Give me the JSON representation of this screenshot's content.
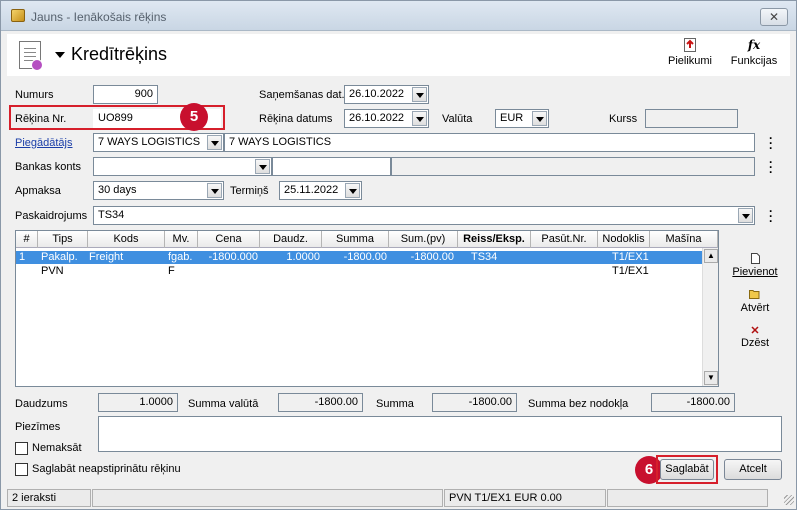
{
  "window": {
    "title": "Jauns - Ienākošais rēķins",
    "close": "✕"
  },
  "header": {
    "title": "Kredītrēķins",
    "attachments_label": "Pielikumi",
    "functions_label": "Funkcijas",
    "functions_icon_text": "fx"
  },
  "form": {
    "numurs_label": "Numurs",
    "numurs_value": "900",
    "rekina_nr_label": "Rēķina Nr.",
    "rekina_nr_value": "UO899",
    "sanemsanas_label": "Saņemšanas dat.",
    "sanemsanas_value": "26.10.2022",
    "rekina_datums_label": "Rēķina datums",
    "rekina_datums_value": "26.10.2022",
    "valuta_label": "Valūta",
    "valuta_value": "EUR",
    "kurss_label": "Kurss",
    "kurss_value": "",
    "piegadatajs_label": "Piegādātājs",
    "piegadatajs_code": "7 WAYS LOGISTICS",
    "piegadatajs_name": "7 WAYS LOGISTICS",
    "bankas_konts_label": "Bankas konts",
    "bankas_konts_value": "",
    "apmaksa_label": "Apmaksa",
    "apmaksa_value": "30 days",
    "termins_label": "Termiņš",
    "termins_value": "25.11.2022",
    "paskaidrojums_label": "Paskaidrojums",
    "paskaidrojums_value": "TS34"
  },
  "callouts": {
    "first": "5",
    "second": "6"
  },
  "table": {
    "headers": [
      "#",
      "Tips",
      "Kods",
      "Mv.",
      "Cena",
      "Daudz.",
      "Summa",
      "Sum.(pv)",
      "Reiss/Eksp.",
      "Pasūt.Nr.",
      "Nodoklis",
      "Mašīna"
    ],
    "rows": [
      [
        "1",
        "Pakalp.",
        "Freight",
        "fgab.",
        "-1800.000",
        "1.0000",
        "-1800.00",
        "-1800.00",
        "TS34",
        "",
        "T1/EX1",
        ""
      ],
      [
        "",
        "PVN",
        "",
        "F",
        "",
        "",
        "",
        "",
        "",
        "",
        "T1/EX1",
        ""
      ]
    ]
  },
  "side_buttons": {
    "add": "Pievienot",
    "open": "Atvērt",
    "delete": "Dzēst"
  },
  "totals": {
    "daudzums_label": "Daudzums",
    "daudzums_value": "1.0000",
    "summa_valuta_label": "Summa valūtā",
    "summa_valuta_value": "-1800.00",
    "summa_label": "Summa",
    "summa_value": "-1800.00",
    "summa_bez_label": "Summa bez nodokļa",
    "summa_bez_value": "-1800.00"
  },
  "notes": {
    "piezimes_label": "Piezīmes",
    "nemaksat_label": "Nemaksāt",
    "saglabat_neapst_label": "Saglabāt neapstiprinātu rēķinu"
  },
  "buttons": {
    "save": "Saglabāt",
    "cancel": "Atcelt"
  },
  "status": {
    "count": "2 ieraksti",
    "tax": "PVN T1/EX1 EUR 0.00"
  }
}
